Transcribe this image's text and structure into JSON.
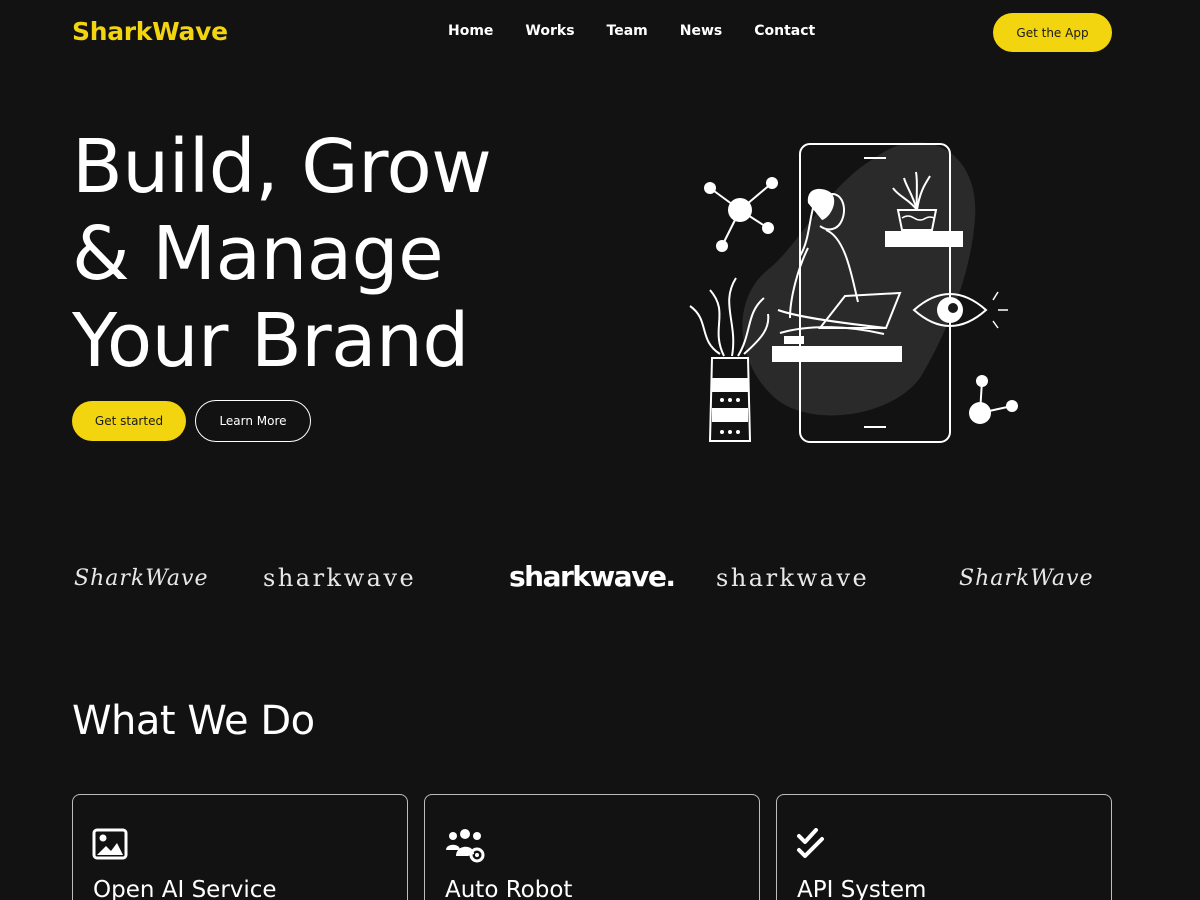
{
  "header": {
    "logo": "SharkWave",
    "nav": [
      "Home",
      "Works",
      "Team",
      "News",
      "Contact"
    ],
    "cta_label": "Get the App"
  },
  "hero": {
    "title_lines": [
      "Build, Grow",
      "& Manage",
      "Your Brand"
    ],
    "primary_button": "Get started",
    "secondary_button": "Learn More",
    "illustration_icon": "person-laptop-phone-illustration"
  },
  "brands": [
    "SharkWave",
    "sharkwave",
    "sharkwave.",
    "sharkwave",
    "SharkWave"
  ],
  "services": {
    "title": "What We Do",
    "cards": [
      {
        "icon": "image-icon",
        "title": "Open AI Service"
      },
      {
        "icon": "users-gear-icon",
        "title": "Auto Robot"
      },
      {
        "icon": "double-check-icon",
        "title": "API System"
      }
    ]
  },
  "colors": {
    "background": "#121212",
    "accent": "#f2d40f",
    "text": "#ffffff"
  }
}
